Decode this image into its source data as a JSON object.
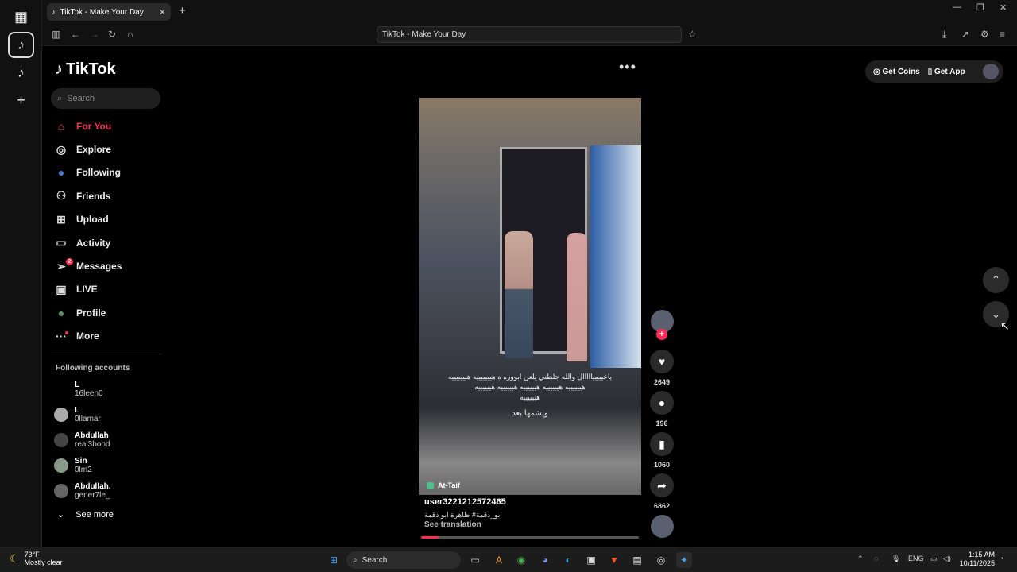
{
  "browser": {
    "tab_title": "TikTok - Make Your Day",
    "url": "TikTok - Make Your Day"
  },
  "tiktok": {
    "logo": "TikTok",
    "search_placeholder": "Search",
    "nav": [
      {
        "label": "For You",
        "icon": "home-icon",
        "glyph": "⌂"
      },
      {
        "label": "Explore",
        "icon": "compass-icon",
        "glyph": "◎"
      },
      {
        "label": "Following",
        "icon": "following-avatar-icon",
        "glyph": "●"
      },
      {
        "label": "Friends",
        "icon": "friends-icon",
        "glyph": "⚇"
      },
      {
        "label": "Upload",
        "icon": "upload-icon",
        "glyph": "⊞"
      },
      {
        "label": "Activity",
        "icon": "activity-icon",
        "glyph": "▭"
      },
      {
        "label": "Messages",
        "icon": "messages-icon",
        "glyph": "➢"
      },
      {
        "label": "LIVE",
        "icon": "live-icon",
        "glyph": "▣"
      },
      {
        "label": "Profile",
        "icon": "profile-avatar-icon",
        "glyph": "●"
      },
      {
        "label": "More",
        "icon": "more-dots-icon",
        "glyph": "···"
      }
    ],
    "messages_badge": "2",
    "following_title": "Following accounts",
    "accounts": [
      {
        "name": "L",
        "handle": "16leen0"
      },
      {
        "name": "L",
        "handle": "0llamar"
      },
      {
        "name": "Abdullah",
        "handle": "real3bood"
      },
      {
        "name": "Sin",
        "handle": "0lm2"
      },
      {
        "name": "Abdullah.",
        "handle": "gener7le_"
      }
    ],
    "see_more": "See more",
    "get_coins": "Get Coins",
    "get_app": "Get App"
  },
  "video": {
    "caption_line1": "ياعيييييااااال والله جلطني يلعن ابووره ه هيييييييه هيييييييه",
    "caption_line2": "هييييييه هييييييه هييييييه هييييييه هييييييه",
    "caption_line3": "هييييييه",
    "caption_line4": "ويشمها بعد",
    "location": "At-Taif",
    "username": "user3221212572465",
    "description": "ابو_دقمة# ظاهرة ابو دقمة",
    "see_translation": "See translation",
    "progress": 0.08,
    "likes": "2649",
    "comments": "196",
    "saves": "1060",
    "shares": "6862"
  },
  "taskbar": {
    "temp": "73°F",
    "weather": "Mostly clear",
    "search": "Search",
    "lang": "ENG",
    "time": "1:15 AM",
    "date": "10/11/2025"
  },
  "colors": {
    "accent": "#fe2c55",
    "background": "#000000"
  }
}
